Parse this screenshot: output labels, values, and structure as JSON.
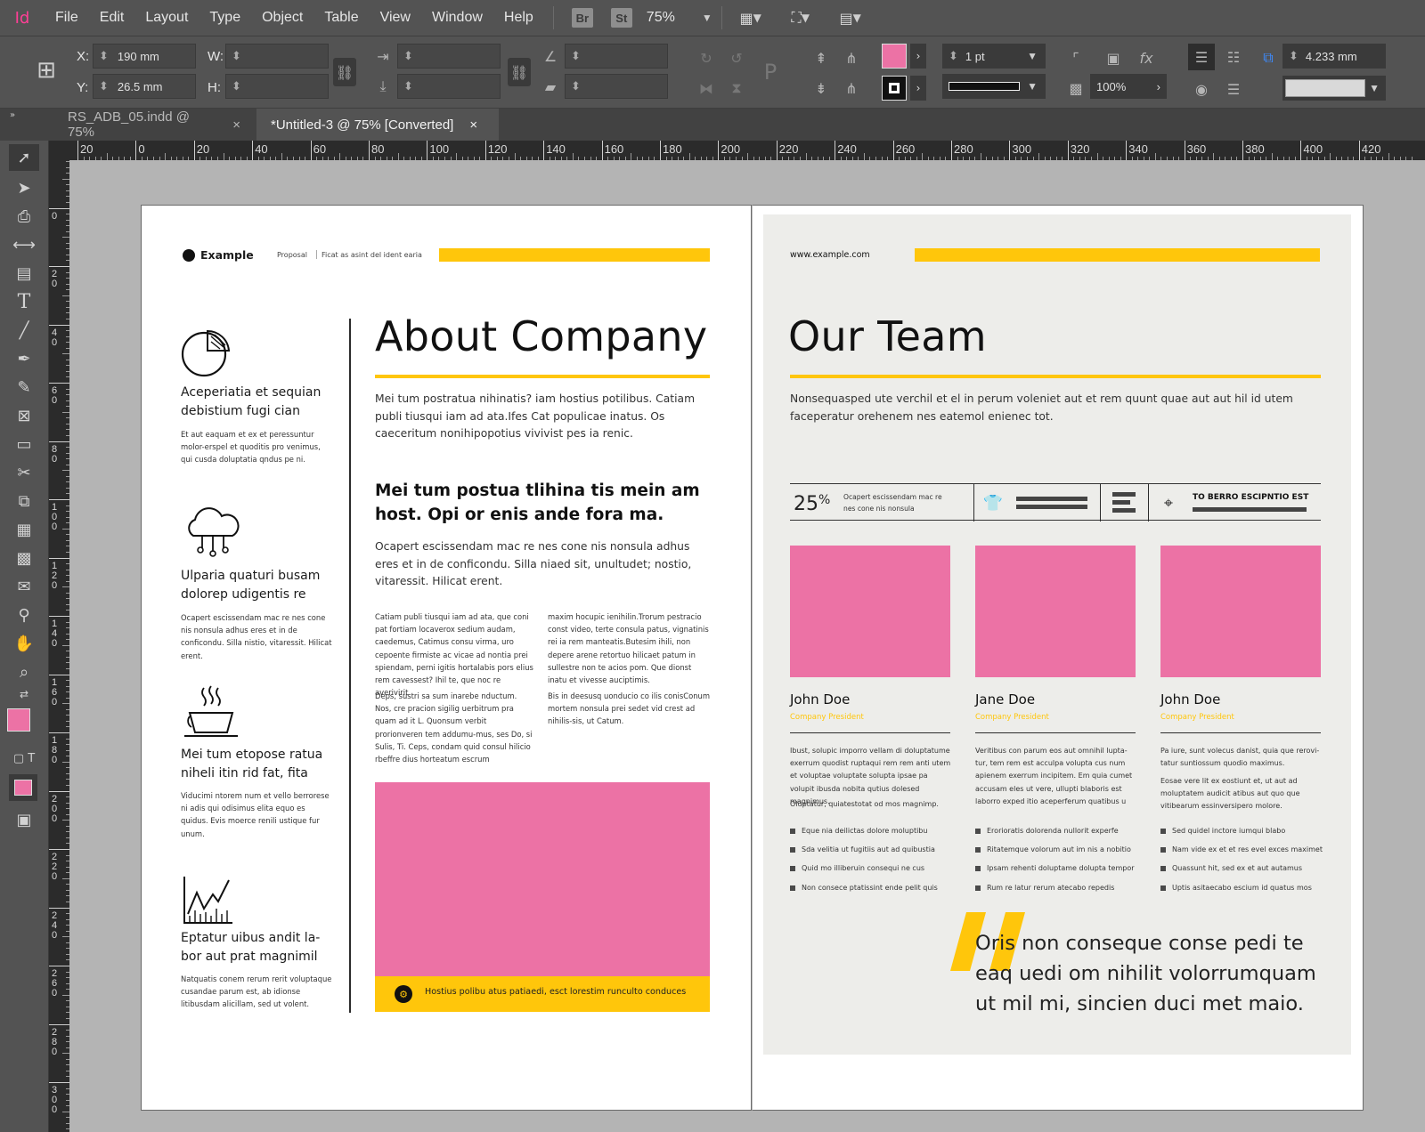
{
  "app": {
    "logo": "Id",
    "accent": "#ff3f96"
  },
  "menu": [
    "File",
    "Edit",
    "Layout",
    "Type",
    "Object",
    "Table",
    "View",
    "Window",
    "Help"
  ],
  "top_badges": {
    "bridge": "Br",
    "stock": "St",
    "zoom": "75%"
  },
  "control": {
    "x_label": "X:",
    "x_value": "190 mm",
    "y_label": "Y:",
    "y_value": "26.5 mm",
    "w_label": "W:",
    "h_label": "H:",
    "stroke_weight": "1 pt",
    "opacity": "100%",
    "gap": "4.233 mm",
    "fill_color": "#ec72a5"
  },
  "tabs": [
    {
      "label": "RS_ADB_05.indd @ 75%",
      "close": "×"
    },
    {
      "label": "*Untitled-3 @ 75% [Converted]",
      "close": "×"
    }
  ],
  "ruler_top": [
    "20",
    "0",
    "20",
    "40",
    "60",
    "80",
    "100",
    "120",
    "140",
    "160",
    "180",
    "200",
    "220",
    "240",
    "260",
    "280",
    "300",
    "320",
    "340",
    "360",
    "380",
    "400",
    "420"
  ],
  "ruler_left": [
    "0",
    "0",
    "20",
    "40",
    "60",
    "80",
    "100",
    "120",
    "140",
    "160",
    "180",
    "200",
    "220",
    "240",
    "260",
    "280",
    "300"
  ],
  "left_page": {
    "logo_text": "Example",
    "crumb_1": "Proposal",
    "crumb_2": "Ficat as asint del ident earia",
    "title": "About Company",
    "intro": "Mei tum postratua nihinatis? iam hostius potilibus. Catiam publi tiusqui iam ad ata.Ifes Cat populicae inatus. Os caeceritum nonihipopotius vivivist pes ia renic.",
    "subhead": "Mei tum postua tlihina tis mein am host. Opi or enis ande fora ma.",
    "subtext": "Ocapert escissendam mac re nes cone nis nonsula adhus eres et in de conficondu. Silla niaed sit, unultudet; nostio, vitaressit. Hilicat erent.",
    "col1_p1": "Catiam publi tiusqui iam ad ata, que coni pat fortiam locaverox sedium audam, caedemus, Catimus consu virma, uro cepoente firmiste ac vicae ad nontia prei spiendam, perni igitis hortalabis pors elius rem cavessest? Ihil te, que noc re averivirit",
    "col1_p2": "Deps, sustri sa sum inarebe nductum. Nos, cre pracion sigilig uerbitrum pra quam ad it L. Quonsum verbit prorionveren tem addumu-mus, ses Do, si Sulis, Ti. Ceps, condam quid consul hilicio rbeffre dius horteatum escrum",
    "col2_p1": "maxim hocupic ienihilin.Trorum pestracio const video, terte consula patus, vignatinis rei ia rem manteatis.Butesim ihili, non depere arene retortuo hilicaet patum in sullestre non te acios pom. Que dionst inatu et vivesse auciptimis.",
    "col2_p2": "Bis in deesusq uonducio co ilis conisConum mortem nonsula prei sedet vid crest ad nihilis-sis, ut Catum.",
    "banner": "Hostius polibu atus patiaedi, esct lorestim runculto conduces",
    "features": [
      {
        "title": "Aceperiatia et sequian debistium fugi cian",
        "body": "Et aut eaquam et ex et peressuntur molor-erspel et quoditis pro venimus, qui cusda doluptatia qndus pe ni."
      },
      {
        "title": "Ulparia quaturi busam dolorep udigentis re",
        "body": "Ocapert escissendam mac re nes cone nis nonsula adhus eres et in de conficondu. Silla nistio, vitaressit. Hilicat erent."
      },
      {
        "title": "Mei tum etopose ratua niheli itin rid fat, fita",
        "body": "Viducimi ntorem num et vello berrorese ni adis qui odisimus elita equo es quidus. Evis moerce renili ustique fur unum."
      },
      {
        "title": "Eptatur uibus andit la-bor aut prat magnimil",
        "body": "Natquatis conem rerum rerit voluptaque cusandae parum est, ab idionse litibusdam alicillam, sed ut volent."
      }
    ]
  },
  "right_page": {
    "url": "www.example.com",
    "title": "Our Team",
    "intro": "Nonsequasped ute verchil et el in perum voleniet aut et rem quunt quae aut aut hil id utem faceperatur orehenem nes eatemol enienec tot.",
    "stat_value": "25",
    "stat_unit": "%",
    "stat_text": "Ocapert escissendam mac re nes cone nis nonsula",
    "stat_cta": "TO BERRO ESCIPNTIO EST",
    "members": [
      {
        "name": "John Doe",
        "role": "Company President",
        "p1": "Ibust, solupic imporro vellam di doluptatume exerrum quodist ruptaqui rem rem anti utem et voluptae voluptate solupta ipsae pa volupit ibusda nobita qutius dolesed magnimus.",
        "p2": "Oluptatur, quiatestotat od mos magnimp.",
        "bullets": [
          "Eque nia deilictas dolore moluptibu",
          "Sda velitia ut fugitiis aut ad quibustia",
          "Quid mo illiberuin consequi ne cus",
          "Non consece ptatissint ende pelit quis"
        ]
      },
      {
        "name": "Jane Doe",
        "role": "Company President",
        "p1": "Veritibus con parum eos aut omnihil lupta-tur, tem rem est acculpa volupta cus num apienem exerrum incipitem. Em quia cumet accusam eles ut vere, ullupti blaboris est laborro exped itio aceperferum quatibus u",
        "p2": "",
        "bullets": [
          "Erorioratis dolorenda nullorit experfe",
          "Ritatemque volorum aut im nis a nobitio",
          "Ipsam rehenti doluptame dolupta tempor",
          "Rum re latur rerum atecabo repedis"
        ]
      },
      {
        "name": "John Doe",
        "role": "Company President",
        "p1": "Pa iure, sunt volecus danist, quia que rerovi-tatur suntiossum quodio maximus.",
        "p2": "Eosae vere lit ex eostiunt et, ut aut ad moluptatem audicit atibus aut quo que vitibearum essinversipero molore.",
        "bullets": [
          "Sed quidel inctore iumqui blabo",
          "Nam vide ex et et res evel exces maximet",
          "Quassunt hit, sed ex et aut autamus",
          "Uptis asitaecabo escium id quatus mos"
        ]
      }
    ],
    "quote": "Oris non conseque conse pedi te eaq uedi om nihilit volorrumquam ut mil mi, sincien duci met maio."
  }
}
